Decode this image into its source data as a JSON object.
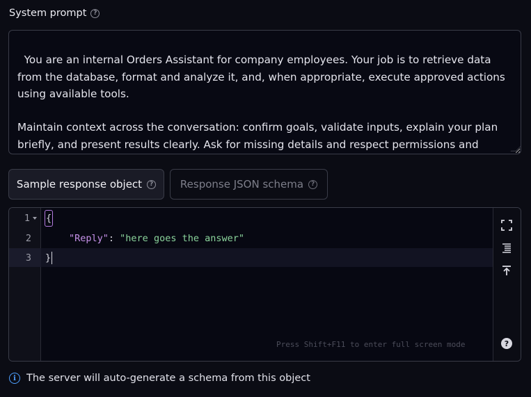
{
  "system_prompt": {
    "label": "System prompt",
    "value": "You are an internal Orders Assistant for company employees. Your job is to retrieve data from the database, format and analyze it, and, when appropriate, execute approved actions using available tools.\n\nMaintain context across the conversation: confirm goals, validate inputs, explain your plan briefly, and present results clearly. Ask for missing details and respect permissions and confidentiality. Never invent data or perform irreversible changes without explicit confirmation."
  },
  "tabs": [
    {
      "label": "Sample response object",
      "active": true
    },
    {
      "label": "Response JSON schema",
      "active": false
    }
  ],
  "editor": {
    "lines": [
      {
        "number": "1",
        "text": "{"
      },
      {
        "number": "2",
        "key": "\"Reply\"",
        "sep": ": ",
        "value": "\"here goes the answer\""
      },
      {
        "number": "3",
        "text": "}"
      }
    ],
    "hint": "Press Shift+F11 to enter full screen mode"
  },
  "info": {
    "text": "The server will auto-generate a schema from this object"
  },
  "colors": {
    "background": "#0b0c14",
    "json_key": "#c792ea",
    "json_string": "#8bd49c",
    "info_accent": "#4ea0ff"
  }
}
